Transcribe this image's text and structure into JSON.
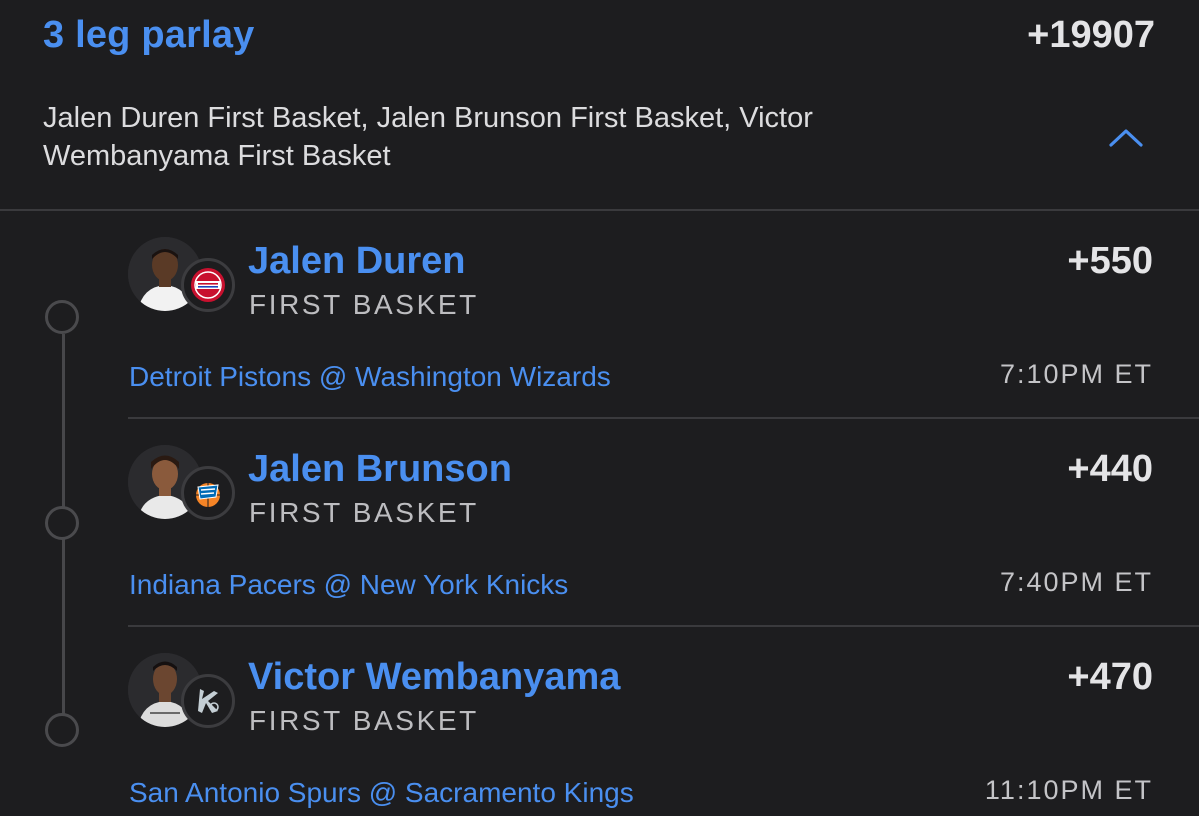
{
  "parlay": {
    "title": "3 leg parlay",
    "odds": "+19907",
    "summary": "Jalen Duren First Basket, Jalen Brunson First Basket, Victor Wembanyama First Basket",
    "toggle_icon": "chevron-up-icon"
  },
  "legs": [
    {
      "player": "Jalen Duren",
      "market": "FIRST BASKET",
      "odds": "+550",
      "matchup": "Detroit Pistons @ Washington Wizards",
      "time": "7:10PM ET",
      "team_logo": "pistons-logo",
      "team_logo_text": "DETROIT PISTONS"
    },
    {
      "player": "Jalen Brunson",
      "market": "FIRST BASKET",
      "odds": "+440",
      "matchup": "Indiana Pacers @ New York Knicks",
      "time": "7:40PM ET",
      "team_logo": "knicks-logo",
      "team_logo_text": "KNICKS"
    },
    {
      "player": "Victor Wembanyama",
      "market": "FIRST BASKET",
      "odds": "+470",
      "matchup": "San Antonio Spurs @ Sacramento Kings",
      "time": "11:10PM ET",
      "team_logo": "spurs-logo",
      "team_logo_text": "SPURS"
    }
  ],
  "colors": {
    "background": "#1d1d1f",
    "accent": "#4a8ff0",
    "text": "#e4e4e6",
    "muted": "#bdbdc0",
    "divider": "#3a3a3d"
  }
}
